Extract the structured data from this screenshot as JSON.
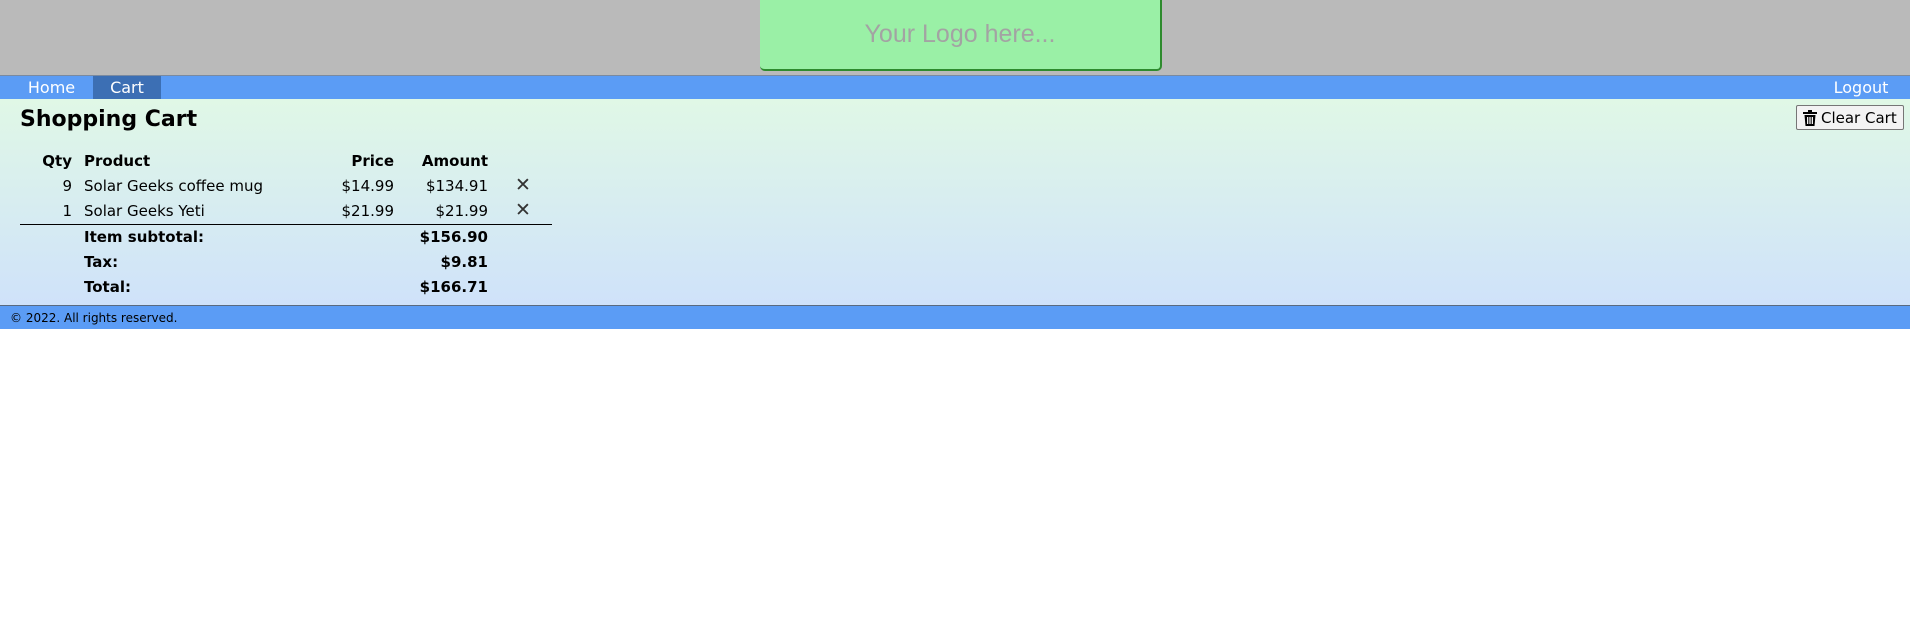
{
  "header": {
    "logo_text": "Your Logo here..."
  },
  "nav": {
    "home": "Home",
    "cart": "Cart",
    "logout": "Logout"
  },
  "main": {
    "title": "Shopping Cart",
    "clear_cart_label": "Clear Cart"
  },
  "cart": {
    "columns": {
      "qty": "Qty",
      "product": "Product",
      "price": "Price",
      "amount": "Amount"
    },
    "items": [
      {
        "qty": "9",
        "product": "Solar Geeks coffee mug",
        "price": "$14.99",
        "amount": "$134.91"
      },
      {
        "qty": "1",
        "product": "Solar Geeks Yeti",
        "price": "$21.99",
        "amount": "$21.99"
      }
    ],
    "summary": {
      "subtotal_label": "Item subtotal:",
      "subtotal_value": "$156.90",
      "tax_label": "Tax:",
      "tax_value": "$9.81",
      "total_label": "Total:",
      "total_value": "$166.71"
    }
  },
  "footer": {
    "text": "© 2022. All rights reserved."
  },
  "colors": {
    "header_bg": "#bababa",
    "logo_bg": "#9af0a6",
    "nav_bg": "#5b9cf5",
    "nav_active_bg": "#3c6fb4"
  }
}
